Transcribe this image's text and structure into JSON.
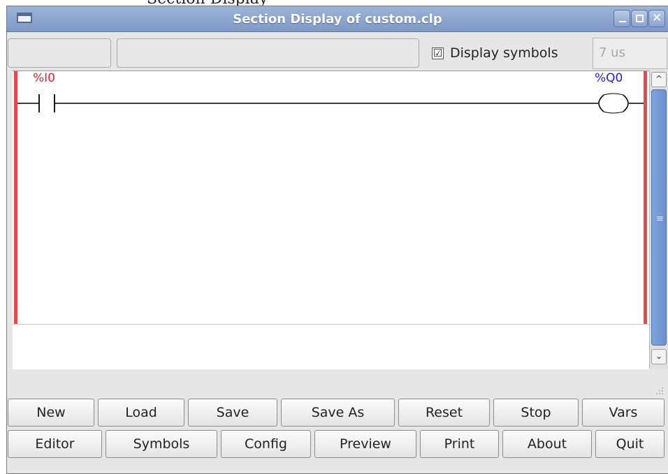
{
  "window": {
    "title": "Section Display of custom.clp",
    "colors": {
      "titlebar": "#8aa4d0",
      "rail": "#e8474b",
      "input_label": "#e8202a",
      "output_label": "#1a1aff"
    }
  },
  "caption_fragment": "Section Display",
  "toolbar": {
    "display_symbols_label": "Display symbols",
    "display_symbols_checked": true,
    "checkbox_mark": "☑",
    "cycle_time": "7 us"
  },
  "ladder": {
    "rungs": [
      {
        "contact": {
          "label": "%I0",
          "type": "normally-open-contact"
        },
        "coil": {
          "label": "%Q0",
          "type": "coil"
        }
      }
    ]
  },
  "scrollbar": {
    "up_icon": "chevron-up-icon",
    "down_icon": "chevron-down-icon",
    "up_glyph": "^",
    "down_glyph": "⌄",
    "grip_glyph": "≡"
  },
  "buttons": {
    "row1": [
      "New",
      "Load",
      "Save",
      "Save As",
      "Reset",
      "Stop",
      "Vars"
    ],
    "row2": [
      "Editor",
      "Symbols",
      "Config",
      "Preview",
      "Print",
      "About",
      "Quit"
    ]
  },
  "window_controls": {
    "minimize": "minimize-icon",
    "maximize": "maximize-icon",
    "close": "close-icon",
    "close_glyph": "✕"
  }
}
